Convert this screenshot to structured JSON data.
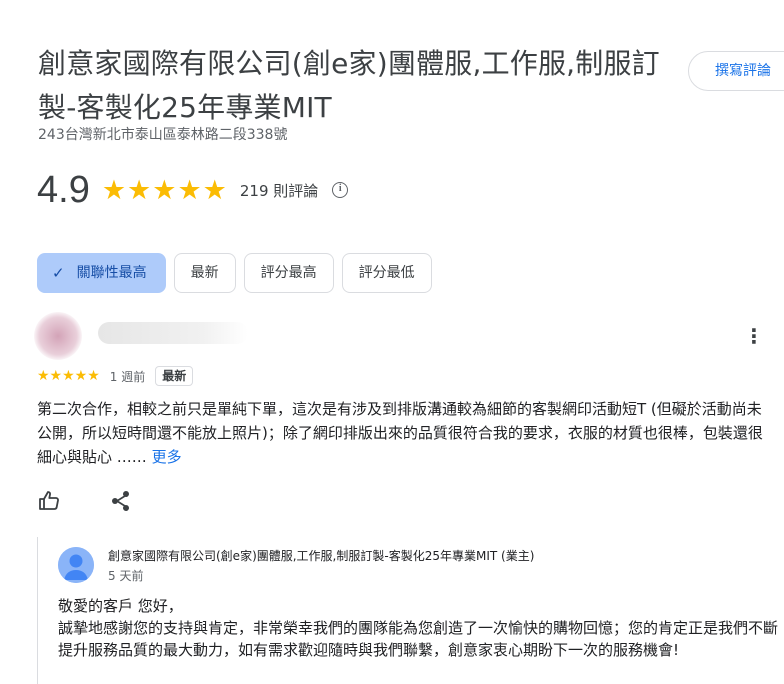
{
  "business": {
    "title": "創意家國際有限公司(創e家)團體服,工作服,制服訂製-客製化25年專業MIT",
    "address": "243台灣新北市泰山區泰林路二段338號",
    "rating": "4.9",
    "stars": "★★★★★",
    "review_count": "219 則評論",
    "write_review_label": "撰寫評論"
  },
  "sort": {
    "chips": [
      {
        "label": "關聯性最高",
        "active": true
      },
      {
        "label": "最新"
      },
      {
        "label": "評分最高"
      },
      {
        "label": "評分最低"
      }
    ]
  },
  "review": {
    "stars": "★★★★★",
    "time": "1 週前",
    "badge": "最新",
    "text": "第二次合作，相較之前只是單純下單，這次是有涉及到排版溝通較為細節的客製網印活動短T (但礙於活動尚未公開，所以短時間還不能放上照片)；除了網印排版出來的品質很符合我的要求，衣服的材質也很棒，包裝還很細心與貼心 ……",
    "more_label": "更多"
  },
  "owner_response": {
    "name": "創意家國際有限公司(創e家)團體服,工作服,制服訂製-客製化25年專業MIT (業主)",
    "time": "5 天前",
    "greeting": "敬愛的客戶 您好，",
    "body": "誠摯地感謝您的支持與肯定，非常榮幸我們的團隊能為您創造了一次愉快的購物回憶；您的肯定正是我們不斷提升服務品質的最大動力，如有需求歡迎隨時與我們聯繫，創意家衷心期盼下一次的服務機會!"
  },
  "colors": {
    "star": "#fbbc04",
    "accent": "#1a73e8",
    "active_chip": "#aecbfa"
  },
  "icons": [
    "info-icon",
    "check-icon",
    "more-vert-icon",
    "thumb-up-icon",
    "share-icon",
    "person-icon"
  ]
}
